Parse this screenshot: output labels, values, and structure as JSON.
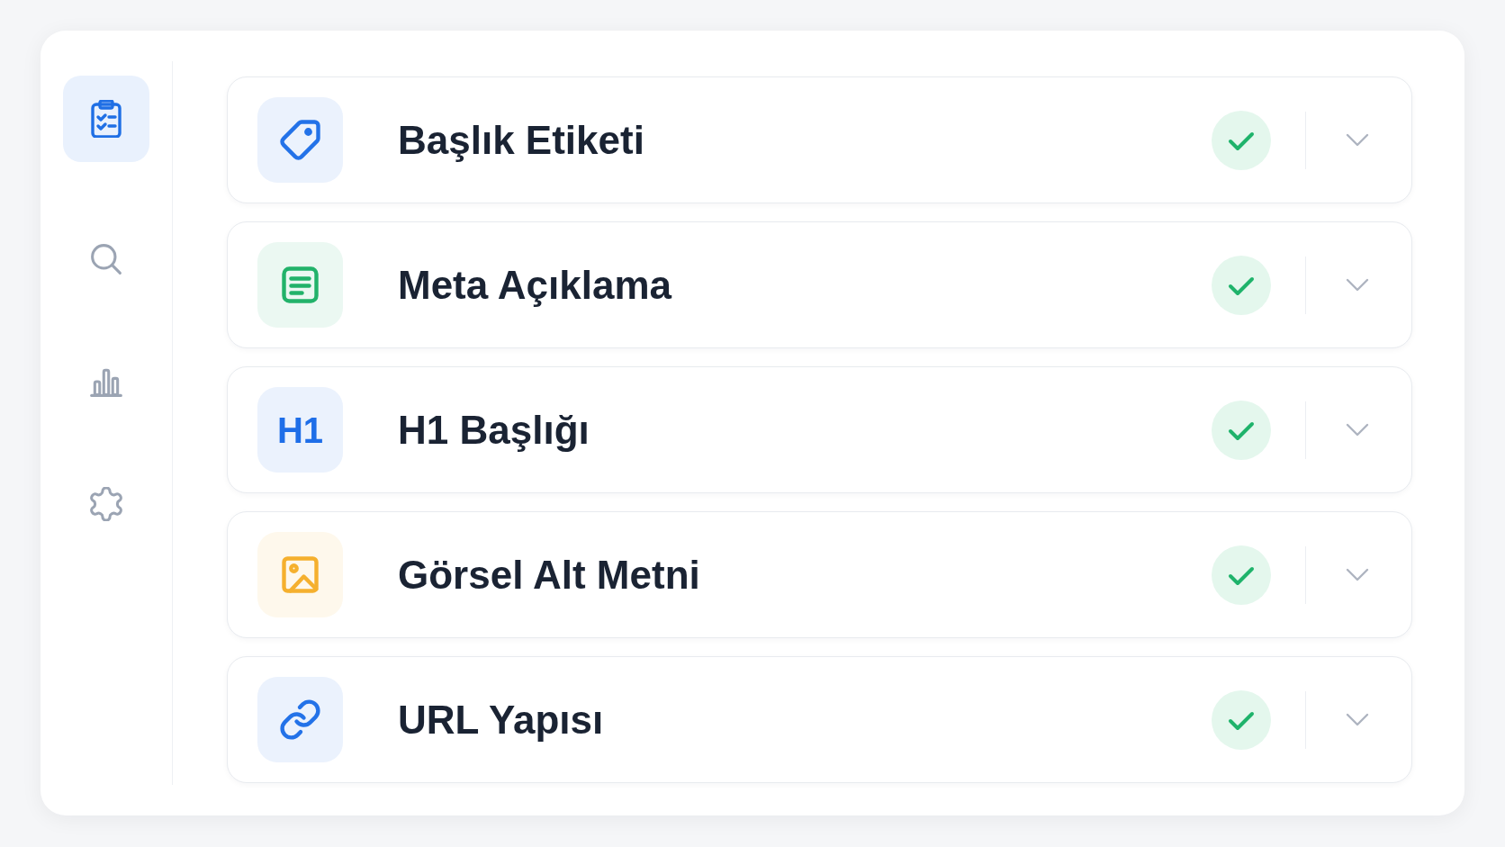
{
  "sidebar": {
    "items": [
      {
        "kind": "checklist",
        "selected": true
      },
      {
        "kind": "search",
        "selected": false
      },
      {
        "kind": "chart",
        "selected": false
      },
      {
        "kind": "settings",
        "selected": false
      }
    ]
  },
  "checks": [
    {
      "kind": "tag",
      "title": "Başlık Etiketi",
      "color": "#2372e8",
      "passed": true,
      "expanded": false
    },
    {
      "kind": "document",
      "title": "Meta Açıklama",
      "color": "#22b26a",
      "passed": true,
      "expanded": false
    },
    {
      "kind": "text",
      "badge": "H1",
      "title": "H1 Başlığı",
      "color": "#1e6ee8",
      "passed": true,
      "expanded": false
    },
    {
      "kind": "image",
      "title": "Görsel Alt Metni",
      "color": "#f5b02e",
      "passed": true,
      "expanded": false
    },
    {
      "kind": "link",
      "title": "URL Yapısı",
      "color": "#2372e8",
      "passed": true,
      "expanded": false
    }
  ]
}
